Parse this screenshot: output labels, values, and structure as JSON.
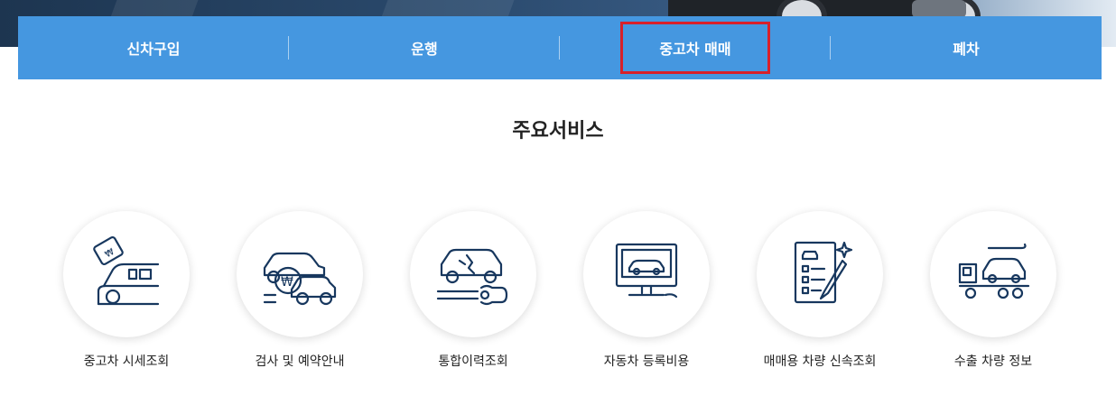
{
  "nav": {
    "items": [
      {
        "label": "신차구입",
        "highlighted": false
      },
      {
        "label": "운행",
        "highlighted": false
      },
      {
        "label": "중고차 매매",
        "highlighted": true
      },
      {
        "label": "폐차",
        "highlighted": false
      }
    ]
  },
  "section": {
    "title": "주요서비스"
  },
  "services": [
    {
      "label": "중고차 시세조회",
      "icon": "car-price-tag-icon"
    },
    {
      "label": "검사 및 예약안내",
      "icon": "car-inspection-won-icon"
    },
    {
      "label": "통합이력조회",
      "icon": "car-repair-history-icon"
    },
    {
      "label": "자동차 등록비용",
      "icon": "car-monitor-icon"
    },
    {
      "label": "매매용 차량 신속조회",
      "icon": "car-checklist-icon"
    },
    {
      "label": "수출 차량 정보",
      "icon": "car-export-truck-icon"
    }
  ],
  "colors": {
    "nav_bg": "#4597e0",
    "highlight": "#d8202a",
    "icon": "#17375e"
  }
}
